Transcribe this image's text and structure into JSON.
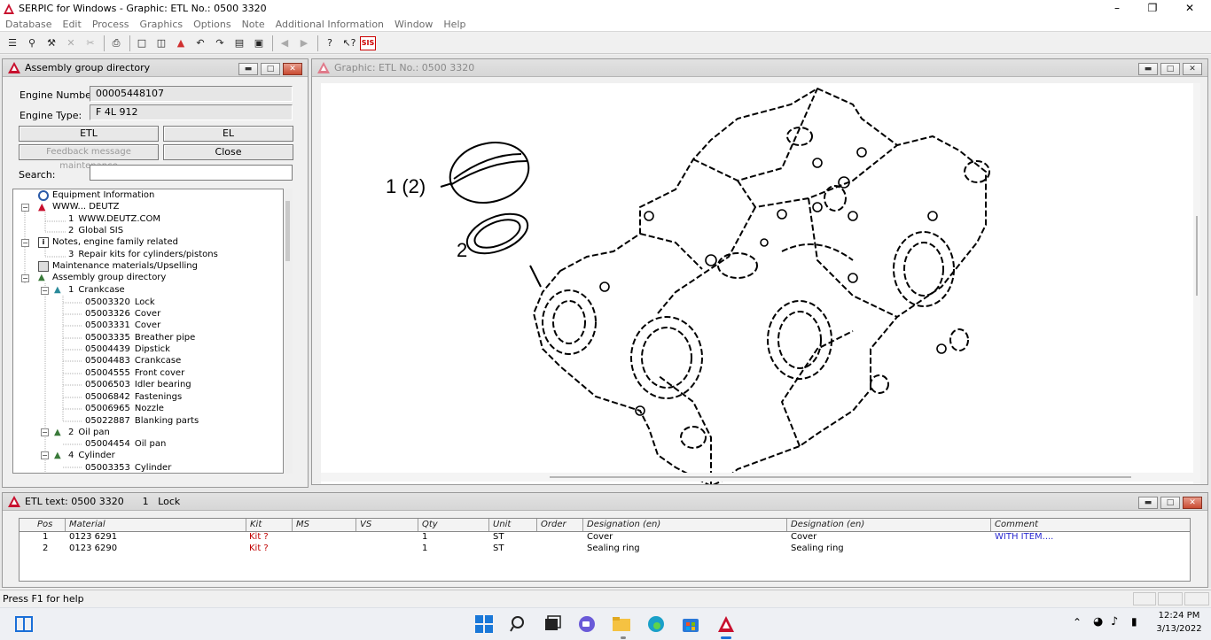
{
  "app": {
    "title": "SERPIC for Windows - Graphic: ETL No.: 0500 3320"
  },
  "menu": [
    "Database",
    "Edit",
    "Process",
    "Graphics",
    "Options",
    "Note",
    "Additional Information",
    "Window",
    "Help"
  ],
  "toolbar": {
    "sis_label": "SIS"
  },
  "assembly": {
    "title": "Assembly group directory",
    "engine_number_label": "Engine Number:",
    "engine_number": "00005448107",
    "engine_type_label": "Engine Type:",
    "engine_type": "F 4L 912",
    "etl_button": "ETL",
    "el_button": "EL",
    "feedback_button": "Feedback message maintenance",
    "close_button": "Close",
    "search_label": "Search:"
  },
  "tree": {
    "n0": "Equipment Information",
    "n1": "WWW... DEUTZ",
    "n2num": "1",
    "n2": "WWW.DEUTZ.COM",
    "n3num": "2",
    "n3": "Global SIS",
    "n4": "Notes, engine family related",
    "n5num": "3",
    "n5": "Repair kits for cylinders/pistons",
    "n6": "Maintenance materials/Upselling",
    "n7": "Assembly group directory",
    "n8num": "1",
    "n8": "Crankcase",
    "c1num": "05003320",
    "c1": "Lock",
    "c2num": "05003326",
    "c2": "Cover",
    "c3num": "05003331",
    "c3": "Cover",
    "c4num": "05003335",
    "c4": "Breather pipe",
    "c5num": "05004439",
    "c5": "Dipstick",
    "c6num": "05004483",
    "c6": "Crankcase",
    "c7num": "05004555",
    "c7": "Front cover",
    "c8num": "05006503",
    "c8": "Idler bearing",
    "c9num": "05006842",
    "c9": "Fastenings",
    "c10num": "05006965",
    "c10": "Nozzle",
    "c11num": "05022887",
    "c11": "Blanking parts",
    "n9num": "2",
    "n9": "Oil pan",
    "d1num": "05004454",
    "d1": "Oil pan",
    "n10num": "4",
    "n10": "Cylinder",
    "e1num": "05003353",
    "e1": "Cylinder"
  },
  "graphic": {
    "title": "Graphic: ETL No.: 0500 3320",
    "callout1": "1 (2)",
    "callout2": "2"
  },
  "etl": {
    "title": "ETL text: 0500 3320      1   Lock",
    "columns": [
      "Pos",
      "Material",
      "Kit",
      "MS",
      "VS",
      "Qty",
      "Unit",
      "Order",
      "Designation (en)",
      "Designation (en)",
      "Comment"
    ],
    "rows": [
      [
        "1",
        "0123 6291",
        "Kit ?",
        "",
        "",
        "1",
        "ST",
        "",
        "Cover",
        "Cover",
        "WITH ITEM...."
      ],
      [
        "2",
        "0123 6290",
        "Kit ?",
        "",
        "",
        "1",
        "ST",
        "",
        "Sealing ring",
        "Sealing ring",
        ""
      ]
    ]
  },
  "status": {
    "text": "Press F1 for help"
  },
  "clock": {
    "time": "12:24 PM",
    "date": "3/13/2022"
  },
  "colors": {
    "kit": "#c00000",
    "comment": "#2a2ad0",
    "close_button": "#c94b32"
  }
}
